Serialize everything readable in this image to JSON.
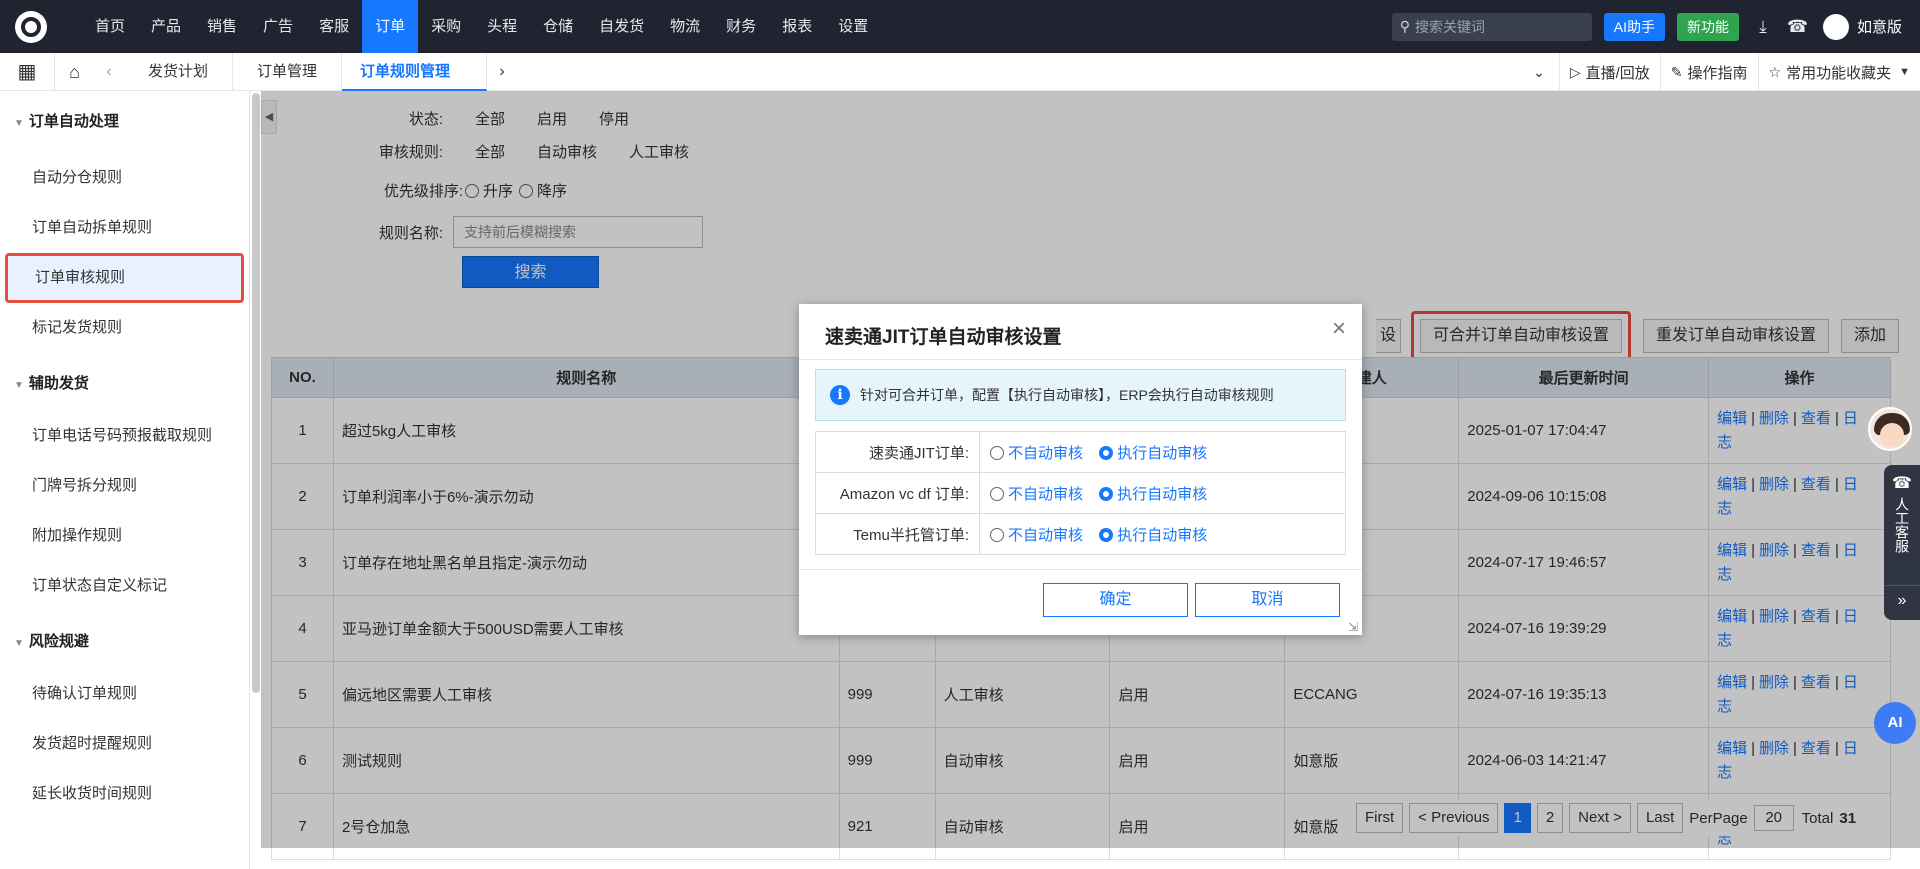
{
  "topnav": {
    "items": [
      "首页",
      "产品",
      "销售",
      "广告",
      "客服",
      "订单",
      "采购",
      "头程",
      "仓储",
      "自发货",
      "物流",
      "财务",
      "报表",
      "设置"
    ],
    "active_index": 5,
    "search_placeholder": "搜索关键词",
    "ai_button": "AI助手",
    "new_button": "新功能",
    "user_name": "如意版"
  },
  "tabbar": {
    "tabs": [
      "发货计划",
      "订单管理",
      "订单规则管理"
    ],
    "active_index": 2,
    "live": "直播/回放",
    "guide": "操作指南",
    "favorites": "常用功能收藏夹"
  },
  "sidebar": {
    "groups": [
      {
        "title": "订单自动处理",
        "items": [
          "自动分仓规则",
          "订单自动拆单规则",
          "订单审核规则",
          "标记发货规则"
        ]
      },
      {
        "title": "辅助发货",
        "items": [
          "订单电话号码预报截取规则",
          "门牌号拆分规则",
          "附加操作规则",
          "订单状态自定义标记"
        ]
      },
      {
        "title": "风险规避",
        "items": [
          "待确认订单规则",
          "发货超时提醒规则",
          "延长收货时间规则"
        ]
      }
    ],
    "active_item": "订单审核规则"
  },
  "filters": {
    "status_label": "状态:",
    "status_opts": [
      "全部",
      "启用",
      "停用"
    ],
    "audit_label": "审核规则:",
    "audit_opts": [
      "全部",
      "自动审核",
      "人工审核"
    ],
    "priority_label": "优先级排序:",
    "priority_opts": [
      "升序",
      "降序"
    ],
    "name_label": "规则名称:",
    "name_placeholder": "支持前后模糊搜索",
    "search_button": "搜索"
  },
  "actions": {
    "hidden_btn": "设",
    "merge_btn": "可合并订单自动审核设置",
    "resend_btn": "重发订单自动审核设置",
    "add_btn": "添加"
  },
  "table": {
    "headers": [
      "NO.",
      "规则名称",
      "",
      "",
      "",
      "建人",
      "最后更新时间",
      "操作"
    ],
    "rows": [
      {
        "no": "1",
        "name": "超过5kg人工审核",
        "priority": "",
        "type": "",
        "status": "",
        "creator": "",
        "updated": "2025-01-07 17:04:47"
      },
      {
        "no": "2",
        "name": "订单利润率小于6%-演示勿动",
        "priority": "",
        "type": "",
        "status": "",
        "creator": "",
        "updated": "2024-09-06 10:15:08"
      },
      {
        "no": "3",
        "name": "订单存在地址黑名单且指定-演示勿动",
        "priority": "",
        "type": "",
        "status": "",
        "creator": "",
        "updated": "2024-07-17 19:46:57"
      },
      {
        "no": "4",
        "name": "亚马逊订单金额大于500USD需要人工审核",
        "priority": "",
        "type": "",
        "status": "",
        "creator": "",
        "updated": "2024-07-16 19:39:29"
      },
      {
        "no": "5",
        "name": "偏远地区需要人工审核",
        "priority": "999",
        "type": "人工审核",
        "status": "启用",
        "creator": "ECCANG",
        "updated": "2024-07-16 19:35:13"
      },
      {
        "no": "6",
        "name": "测试规则",
        "priority": "999",
        "type": "自动审核",
        "status": "启用",
        "creator": "如意版",
        "updated": "2024-06-03 14:21:47"
      },
      {
        "no": "7",
        "name": "2号仓加急",
        "priority": "921",
        "type": "自动审核",
        "status": "启用",
        "creator": "如意版",
        "updated": ""
      }
    ],
    "ops": {
      "edit": "编辑",
      "delete": "删除",
      "view": "查看",
      "log1": "日",
      "log2": "志",
      "sep": "|"
    }
  },
  "pager": {
    "first": "First",
    "prev": "< Previous",
    "pages": [
      "1",
      "2"
    ],
    "current": "1",
    "next": "Next >",
    "last": "Last",
    "perpage_label": "PerPage",
    "perpage": "20",
    "total_label": "Total",
    "total": "31"
  },
  "float": {
    "cs_label": "人工客服",
    "cs_icon": "headset-icon",
    "expand_icon": "double-chevron-icon",
    "ai": "AI"
  },
  "modal": {
    "title": "速卖通JIT订单自动审核设置",
    "info": "针对可合并订单，配置【执行自动审核】，ERP会执行自动审核规则",
    "rows": [
      {
        "label": "速卖通JIT订单:",
        "opt_off": "不自动审核",
        "opt_on": "执行自动审核"
      },
      {
        "label": "Amazon vc df 订单:",
        "opt_off": "不自动审核",
        "opt_on": "执行自动审核"
      },
      {
        "label": "Temu半托管订单:",
        "opt_off": "不自动审核",
        "opt_on": "执行自动审核"
      }
    ],
    "confirm": "确定",
    "cancel": "取消"
  }
}
